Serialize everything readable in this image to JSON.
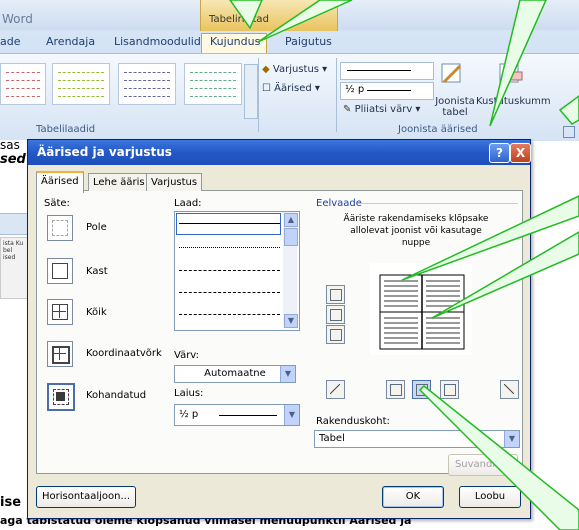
{
  "ribbon": {
    "app_title": "Word",
    "tool_tab_header": "Tabeliriistad",
    "tabs": [
      "ade",
      "Arendaja",
      "Lisandmoodulid",
      "Kujundus",
      "Paigutus"
    ],
    "active_tab": "Kujundus",
    "varjustus_label": "Varjustus",
    "aarised_label": "Äärised",
    "group1_label": "Tabelilaadid",
    "line_weight": "½ p",
    "pen_color_label": "Pliiatsi värv",
    "draw_table_label": "Joonista tabel",
    "eraser_label": "Kustutuskumm",
    "group2_label": "Joonista äärised"
  },
  "background_doc": {
    "left_text_1": "sas",
    "left_text_2": "sed",
    "thumb_text": "ista Ku\nbel\nised",
    "bottom_text_1": "ise",
    "bottom_text_2": "aga täbistatud        oleme klõpsanud viimasel menüüpunktil Äärised ja"
  },
  "dialog": {
    "title": "Äärised ja varjustus",
    "help": "?",
    "close": "X",
    "tabs": [
      "Äärised",
      "Lehe ääris",
      "Varjustus"
    ],
    "settings_label": "Säte:",
    "settings": [
      "Pole",
      "Kast",
      "Kõik",
      "Koordinaatvõrk",
      "Kohandatud"
    ],
    "style_label": "Laad:",
    "color_label": "Värv:",
    "color_value": "Automaatne",
    "width_label": "Laius:",
    "width_value": "½ p",
    "preview_label": "Eelvaade",
    "preview_hint": "Ääriste rakendamiseks klõpsake allolevat joonist või kasutage nuppe",
    "apply_to_label": "Rakenduskoht:",
    "apply_to_value": "Tabel",
    "options_button": "Suvandid...",
    "horizontal_line_button": "Horisontaaljoon...",
    "ok_button": "OK",
    "cancel_button": "Loobu"
  },
  "colors": {
    "callout": "#22bb22",
    "title_bar": "#2458c6",
    "dialog_bg": "#ece9d8",
    "ribbon_bg": "#c5d9f1"
  }
}
